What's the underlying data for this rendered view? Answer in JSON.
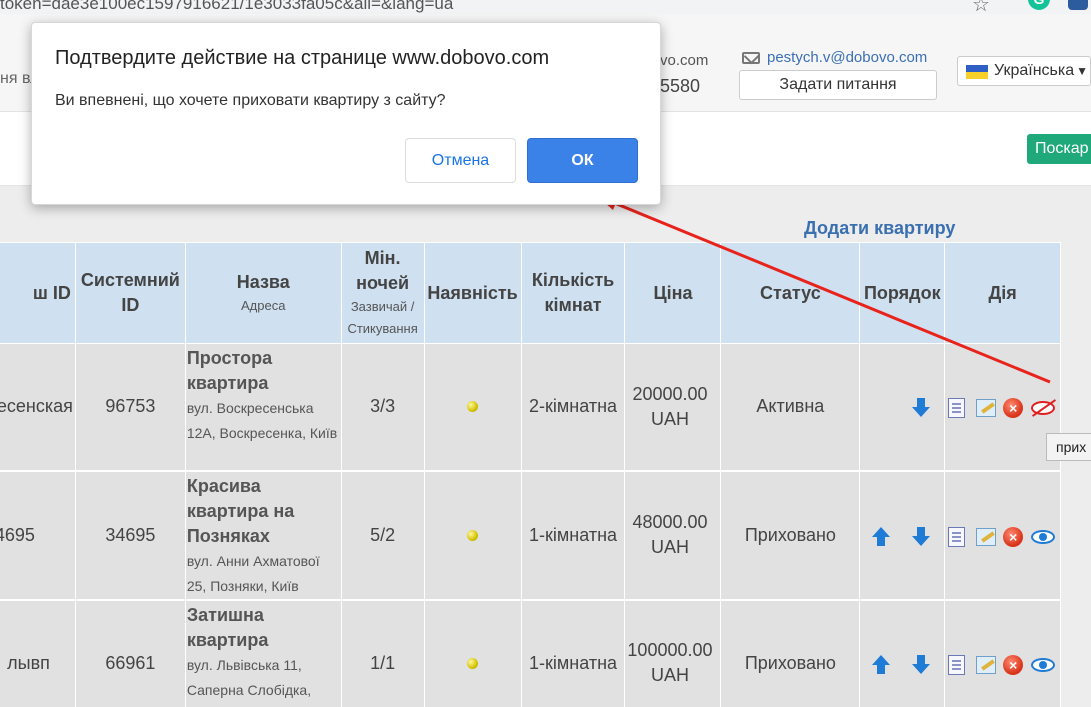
{
  "browser": {
    "url_fragment": "token=dae3e100ec1597916621/1e3033fa05c&all=&lang=ua"
  },
  "header": {
    "left_text": "ня вл",
    "email_partial": "vo.com",
    "phone_partial": "5580",
    "email": "pestych.v@dobovo.com",
    "ask_button": "Задати питання",
    "language": "Українська"
  },
  "subbar": {
    "complain_button": "Поскар"
  },
  "content": {
    "add_apartment_link": "Додати квартиру"
  },
  "table": {
    "headers": {
      "col0": "ш ID",
      "col1": "Системний ID",
      "col2": "Назва",
      "col2_sub": "Адреса",
      "col3": "Мін. ночей",
      "col3_sub": "Зазвичай / Стикування",
      "col4": "Наявність",
      "col5": "Кількість кімнат",
      "col6": "Ціна",
      "col7": "Статус",
      "col8": "Порядок",
      "col9": "Дія"
    },
    "rows": [
      {
        "ext_id": "есенская",
        "sys_id": "96753",
        "title": "Простора квартира",
        "address": "вул. Воскресенська 12А, Воскресенка, Київ",
        "nights": "3/3",
        "rooms": "2-кімнатна",
        "price": "20000.00 UAH",
        "status": "Активна"
      },
      {
        "ext_id": "4695",
        "sys_id": "34695",
        "title": "Красива квартира на Позняках",
        "address": "вул. Анни Ахматової 25, Позняки, Київ",
        "nights": "5/2",
        "rooms": "1-кімнатна",
        "price": "48000.00 UAH",
        "status": "Приховано"
      },
      {
        "ext_id": "лывп",
        "sys_id": "66961",
        "title": "Затишна квартира",
        "address": "вул. Львівська 11, Саперна Слобідка,",
        "nights": "1/1",
        "rooms": "1-кімнатна",
        "price": "100000.00 UAH",
        "status": "Приховано"
      }
    ]
  },
  "tooltip": "прих",
  "dialog": {
    "title": "Подтвердите действие на странице www.dobovo.com",
    "message": "Ви впевнені, що хочете приховати квартиру з сайту?",
    "cancel": "Отмена",
    "ok": "ОК"
  },
  "colors": {
    "accent_blue": "#3b82e8",
    "header_blue": "#cfe0f1",
    "complain_green": "#1fa97a",
    "arrow_red": "#e8231b"
  }
}
